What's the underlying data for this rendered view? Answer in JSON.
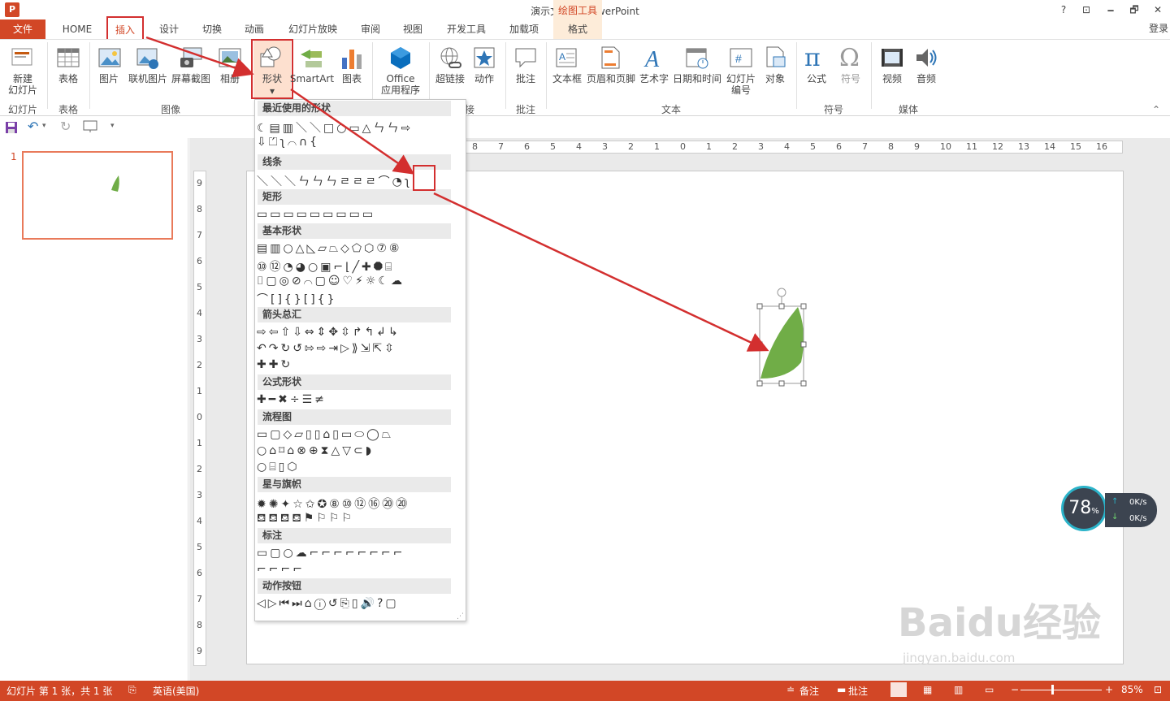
{
  "window": {
    "title": "演示文稿1 - PowerPoint",
    "app_icon": "P",
    "controls": [
      "?",
      "⊡",
      "🗕",
      "🗗",
      "✕"
    ],
    "signin": "登录"
  },
  "context_group": {
    "label": "绘图工具",
    "tab": "格式"
  },
  "tabs": {
    "file": "文件",
    "home": "HOME",
    "insert": "插入",
    "design": "设计",
    "transitions": "切换",
    "animations": "动画",
    "slideshow": "幻灯片放映",
    "review": "审阅",
    "view": "视图",
    "developer": "开发工具",
    "addins": "加载项"
  },
  "ribbon": {
    "new_slide": {
      "line1": "新建",
      "line2": "幻灯片"
    },
    "table": "表格",
    "picture": "图片",
    "online_picture": "联机图片",
    "screenshot": "屏幕截图",
    "album": "相册",
    "shapes": "形状",
    "smartart": "SmartArt",
    "chart": "图表",
    "office_apps": {
      "line1": "Office",
      "line2": "应用程序"
    },
    "hyperlink": "超链接",
    "action": "动作",
    "comment": "批注",
    "textbox": "文本框",
    "header_footer": "页眉和页脚",
    "wordart": "艺术字",
    "datetime": "日期和时间",
    "slide_number": {
      "line1": "幻灯片",
      "line2": "编号"
    },
    "object": "对象",
    "equation": "公式",
    "symbol": "符号",
    "video": "视频",
    "audio": "音频",
    "groups": {
      "slides": "幻灯片",
      "tables": "表格",
      "images": "图像",
      "links": "接",
      "comments": "批注",
      "text": "文本",
      "symbols": "符号",
      "media": "媒体"
    }
  },
  "shapes_dropdown": {
    "categories": [
      {
        "label": "最近使用的形状",
        "rows": [
          "☾▤▥＼＼□○▭△ㄣㄣ⇨",
          "⇩⏍ʅ⌒∩{"
        ]
      },
      {
        "label": "线条",
        "rows": [
          "＼＼＼ㄣㄣㄣㄹㄹㄹ⌒◔ʅ"
        ]
      },
      {
        "label": "矩形",
        "rows": [
          "▭▭▭▭▭▭▭▭▭"
        ]
      },
      {
        "label": "基本形状",
        "rows": [
          "▤▥○△◺▱⏢◇⬠⬡⑦⑧",
          "⑩⑫◔◕○▣⌐⌊╱✚⯃⌸",
          "⌷▢◎⊘⌒▢☺♡⚡☼☾☁",
          "⌒[]{}[]{}"
        ]
      },
      {
        "label": "箭头总汇",
        "rows": [
          "⇨⇦⇧⇩⇔⇕✥⇳↱↰↲↳",
          "↶↷↻↺⇰⇨⇥▷⟫⇲⇱⇳",
          "✚✚↻"
        ]
      },
      {
        "label": "公式形状",
        "rows": [
          "✚━✖÷☰≠"
        ]
      },
      {
        "label": "流程图",
        "rows": [
          "▭▢◇▱▯▯⌂▯▭⬭◯⏢",
          "○⌂⌑⌂⊗⊕⧗△▽⊂◗",
          "○⌸▯⬡"
        ]
      },
      {
        "label": "星与旗帜",
        "rows": [
          "✹✺✦☆✩✪⑧⑩⑫⑯⑳⑳",
          "⛾⛾⛾⛾⚑⚐⚐⚐"
        ]
      },
      {
        "label": "标注",
        "rows": [
          "▭▢○☁⌐⌐⌐⌐⌐⌐⌐⌐",
          "⌐⌐⌐⌐"
        ]
      },
      {
        "label": "动作按钮",
        "rows": [
          "◁▷⏮⏭⌂ⓘ↺⎘▯🔊?▢"
        ]
      }
    ]
  },
  "status": {
    "slide_info": "幻灯片 第 1 张，共 1 张",
    "language": "英语(美国)",
    "notes": "备注",
    "comments": "批注",
    "zoom": "85%"
  },
  "thumbnail": {
    "number": "1"
  },
  "network_widget": {
    "percent": "78",
    "unit": "%",
    "up": "0K/s",
    "down": "0K/s"
  },
  "watermark": {
    "brand": "Baidu经验",
    "url": "jingyan.baidu.com"
  },
  "ruler": {
    "horizontal": [
      "8",
      "7",
      "6",
      "5",
      "4",
      "3",
      "2",
      "1",
      "0",
      "1",
      "2",
      "3",
      "4",
      "5",
      "6",
      "7",
      "8",
      "9",
      "10",
      "11",
      "12",
      "13",
      "14",
      "15",
      "16"
    ],
    "vertical": [
      "9",
      "8",
      "7",
      "6",
      "5",
      "4",
      "3",
      "2",
      "1",
      "0",
      "1",
      "2",
      "3",
      "4",
      "5",
      "6",
      "7",
      "8",
      "9"
    ]
  },
  "colors": {
    "accent": "#d24726",
    "shape_fill": "#70ad47",
    "highlight": "#d32f2f"
  }
}
